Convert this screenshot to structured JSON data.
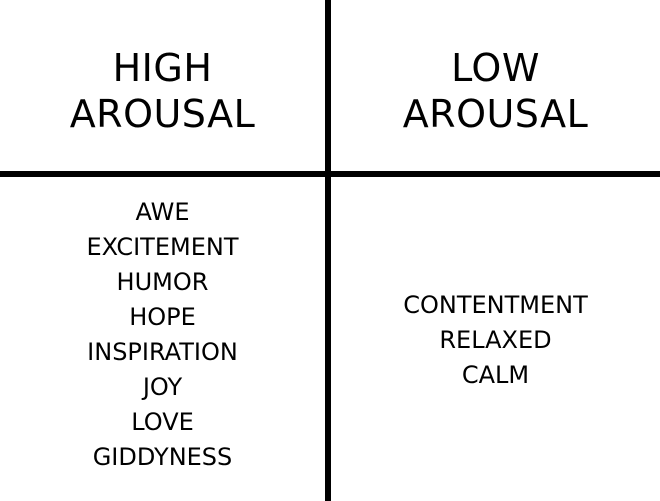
{
  "quadrants": {
    "top_left": {
      "lines": [
        "HIGH",
        "AROUSAL"
      ]
    },
    "top_right": {
      "lines": [
        "LOW",
        "AROUSAL"
      ]
    },
    "bottom_left": {
      "items": [
        "AWE",
        "EXCITEMENT",
        "HUMOR",
        "HOPE",
        "INSPIRATION",
        "JOY",
        "LOVE",
        "GIDDYNESS"
      ]
    },
    "bottom_right": {
      "items": [
        "CONTENTMENT",
        "RELAXED",
        "CALM"
      ]
    }
  },
  "colors": {
    "background": "#ffffff",
    "lines": "#000000",
    "text": "#000000"
  }
}
